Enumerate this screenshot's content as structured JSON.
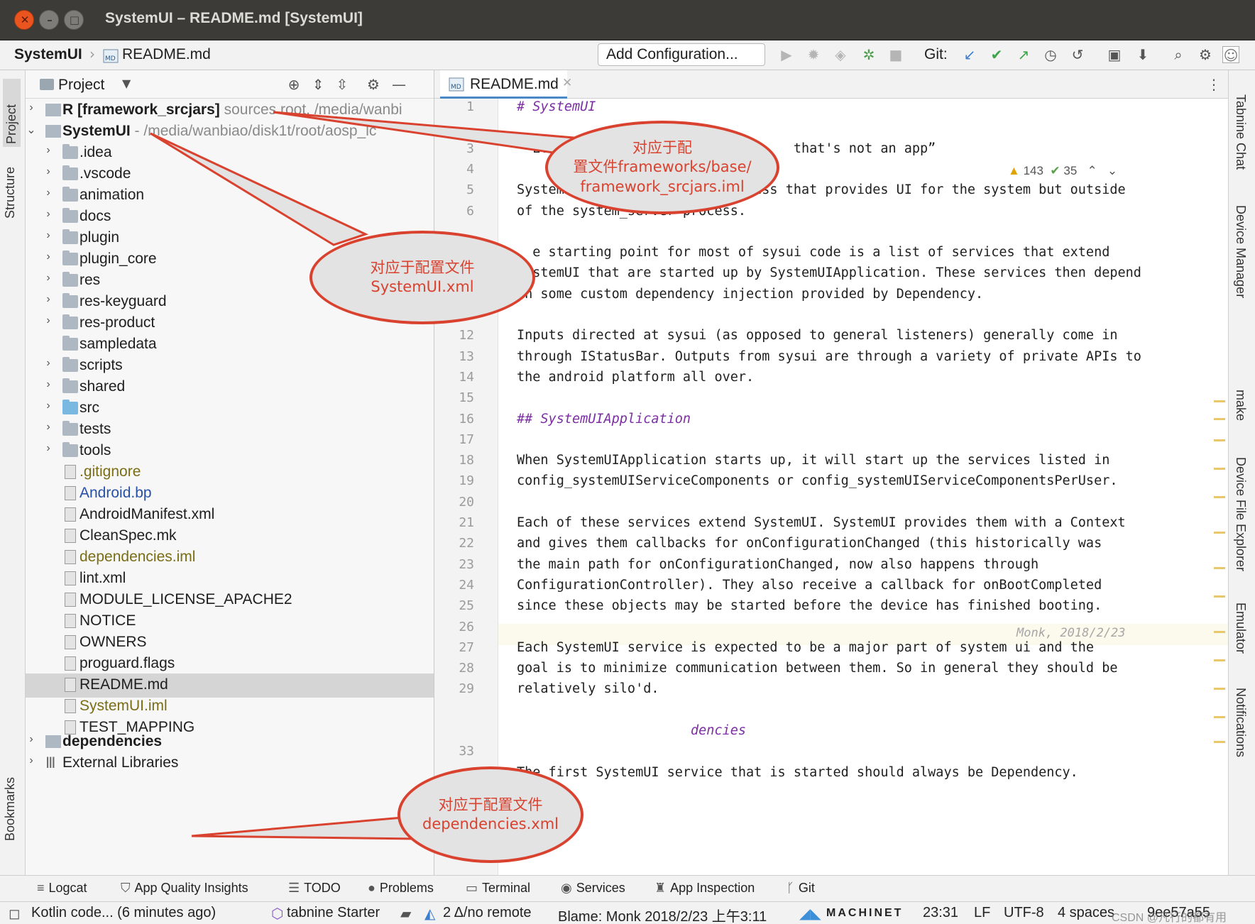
{
  "window": {
    "title": "SystemUI – README.md [SystemUI]"
  },
  "navbar": {
    "project": "SystemUI",
    "file": "README.md",
    "run_config": "Add Configuration...",
    "git_label": "Git:"
  },
  "left_strip": {
    "project_tab": "Project",
    "structure_tab": "Structure",
    "bookmarks_tab": "Bookmarks"
  },
  "right_strip": {
    "tabs": [
      "Tabnine Chat",
      "Device Manager",
      "make",
      "Device File Explorer",
      "Emulator",
      "Notifications"
    ]
  },
  "project_panel": {
    "title": "Project",
    "tree": [
      {
        "name": "R [framework_srcjars]",
        "sub": "  sources root, /media/wanbi"
      },
      {
        "name": "SystemUI",
        "sub": "  - /media/wanbiao/disk1t/root/aosp_lc"
      },
      {
        "name": ".idea"
      },
      {
        "name": ".vscode"
      },
      {
        "name": "animation"
      },
      {
        "name": "docs"
      },
      {
        "name": "plugin"
      },
      {
        "name": "plugin_core"
      },
      {
        "name": "res"
      },
      {
        "name": "res-keyguard"
      },
      {
        "name": "res-product"
      },
      {
        "name": "sampledata"
      },
      {
        "name": "scripts"
      },
      {
        "name": "shared"
      },
      {
        "name": "src"
      },
      {
        "name": "tests"
      },
      {
        "name": "tools"
      },
      {
        "name": ".gitignore"
      },
      {
        "name": "Android.bp"
      },
      {
        "name": "AndroidManifest.xml"
      },
      {
        "name": "CleanSpec.mk"
      },
      {
        "name": "dependencies.iml"
      },
      {
        "name": "lint.xml"
      },
      {
        "name": "MODULE_LICENSE_APACHE2"
      },
      {
        "name": "NOTICE"
      },
      {
        "name": "OWNERS"
      },
      {
        "name": "proguard.flags"
      },
      {
        "name": "README.md"
      },
      {
        "name": "SystemUI.iml"
      },
      {
        "name": "TEST_MAPPING"
      },
      {
        "name": "dependencies"
      },
      {
        "name": "External Libraries"
      }
    ]
  },
  "editor": {
    "tab": "README.md",
    "inspections": {
      "warnings": "143",
      "ok": "35"
    },
    "line_numbers": [
      "1",
      "",
      "3",
      "4",
      "5",
      "6",
      "",
      "",
      "",
      "10",
      "11",
      "12",
      "13",
      "14",
      "15",
      "16",
      "17",
      "18",
      "19",
      "20",
      "21",
      "22",
      "23",
      "24",
      "25",
      "26",
      "27",
      "28",
      "29",
      "",
      "",
      "33"
    ],
    "lines": [
      "# SystemUI",
      "",
      "  Eve                              that's not an app”",
      "",
      "SystemUI is               process that provides UI for the system but outside",
      "of the system_server process.",
      "",
      "  e starting point for most of sysui code is a list of services that extend",
      "SystemUI that are started up by SystemUIApplication. These services then depend",
      "on some custom dependency injection provided by Dependency.",
      "",
      "Inputs directed at sysui (as opposed to general listeners) generally come in",
      "through IStatusBar. Outputs from sysui are through a variety of private APIs to",
      "the android platform all over.",
      "",
      "## SystemUIApplication",
      "",
      "When SystemUIApplication starts up, it will start up the services listed in",
      "config_systemUIServiceComponents or config_systemUIServiceComponentsPerUser.",
      "",
      "Each of these services extend SystemUI. SystemUI provides them with a Context",
      "and gives them callbacks for onConfigurationChanged (this historically was",
      "the main path for onConfigurationChanged, now also happens through",
      "ConfigurationController). They also receive a callback for onBootCompleted",
      "since these objects may be started before the device has finished booting.",
      "",
      "Each SystemUI service is expected to be a major part of system ui and the",
      "goal is to minimize communication between them. So in general they should be",
      "relatively silo'd.",
      "",
      "                      dencies",
      "",
      "The first SystemUI service that is started should always be Dependency."
    ],
    "blame_inline": "Monk, 2018/2/23"
  },
  "bottom_tools": [
    "Logcat",
    "App Quality Insights",
    "TODO",
    "Problems",
    "Terminal",
    "Services",
    "App Inspection",
    "Git"
  ],
  "status": {
    "message": "Kotlin code... (6 minutes ago)",
    "tabnine": "tabnine Starter",
    "git": "2 Δ/no remote",
    "blame": "Blame: Monk 2018/2/23 上午3:11",
    "machinet": "MACHINET",
    "position": "23:31",
    "line_sep": "LF",
    "encoding": "UTF-8",
    "indent": "4 spaces",
    "branch": "9ee57a55",
    "watermark": "CSDN @凡行的都有用"
  },
  "callouts": {
    "c1": "对应于配\n置文件frameworks/base/\nframework_srcjars.iml",
    "c2": "对应于配置文件\nSystemUI.xml",
    "c3": "对应于配置文件\ndependencies.xml"
  },
  "colors": {
    "callout": "#d9422f",
    "accent": "#4a88c7"
  }
}
